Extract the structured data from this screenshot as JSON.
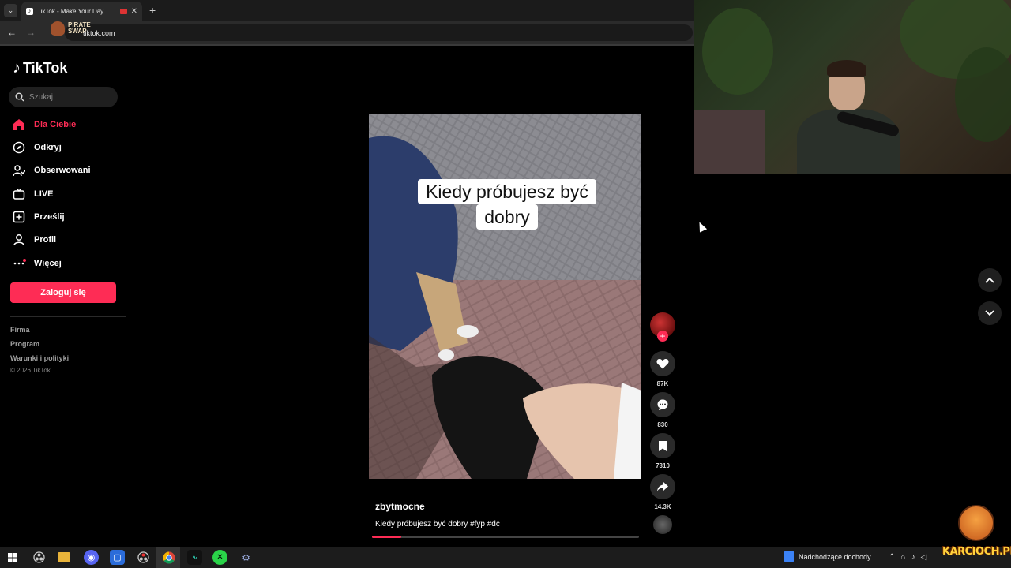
{
  "browser": {
    "tab_title": "TikTok - Make Your Day",
    "tab_close": "✕",
    "new_tab": "+",
    "url": "tiktok.com",
    "extension_label": "PIRATE SWAP"
  },
  "sidebar": {
    "logo_text": "TikTok",
    "search_placeholder": "Szukaj",
    "items": [
      {
        "label": "Dla Ciebie",
        "icon": "home-icon",
        "active": true
      },
      {
        "label": "Odkryj",
        "icon": "compass-icon"
      },
      {
        "label": "Obserwowani",
        "icon": "following-icon"
      },
      {
        "label": "LIVE",
        "icon": "live-icon"
      },
      {
        "label": "Prześlij",
        "icon": "upload-icon"
      },
      {
        "label": "Profil",
        "icon": "profile-icon"
      },
      {
        "label": "Więcej",
        "icon": "more-icon"
      }
    ],
    "login_label": "Zaloguj się",
    "footer": [
      "Firma",
      "Program",
      "Warunki i polityki"
    ],
    "copyright": "© 2026 TikTok"
  },
  "video": {
    "caption_overlay": "Kiedy próbujesz być dobry",
    "author": "zbytmocne",
    "description": "Kiedy próbujesz być dobry #fyp #dc",
    "progress": 0.11
  },
  "actions": {
    "likes": "87K",
    "comments": "830",
    "bookmarks": "7310",
    "shares": "14.3K"
  },
  "taskbar": {
    "notification": "Nadchodzące dochody"
  },
  "watermark": {
    "text": "KARCIOCH.PL"
  },
  "colors": {
    "accent": "#fe2c55",
    "background": "#000000"
  }
}
